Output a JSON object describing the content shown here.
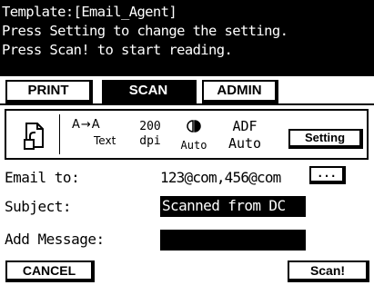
{
  "header": {
    "line1": "Template:[Email_Agent]",
    "line2": "Press Setting to change the setting.",
    "line3": "Press Scan! to start reading."
  },
  "tabs": [
    {
      "label": "PRINT",
      "active": false
    },
    {
      "label": "SCAN",
      "active": true
    },
    {
      "label": "ADMIN",
      "active": false
    }
  ],
  "settings_panel": {
    "ratio_icon": "A→A",
    "ratio_label": "Text",
    "dpi_value": "200",
    "dpi_unit": "dpi",
    "density_icon": "contrast-icon",
    "density_label": "Auto",
    "source_label": "ADF",
    "source_value": "Auto",
    "setting_button": "Setting"
  },
  "email": {
    "label": "Email to:",
    "value": "123@com,456@com",
    "button": "..."
  },
  "subject": {
    "label": "Subject:",
    "value": "Scanned from DC"
  },
  "message": {
    "label": "Add Message:",
    "value": ""
  },
  "buttons": {
    "cancel": "CANCEL",
    "scan": "Scan!"
  }
}
